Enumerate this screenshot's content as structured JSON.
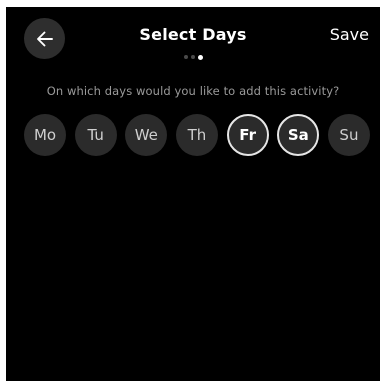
{
  "header": {
    "back_icon": "arrow-left-icon",
    "title": "Select Days",
    "save_label": "Save",
    "page_indicator": {
      "total": 3,
      "current": 3
    }
  },
  "prompt": "On which days would you like to add this activity?",
  "days": [
    {
      "label": "Mo",
      "selected": false
    },
    {
      "label": "Tu",
      "selected": false
    },
    {
      "label": "We",
      "selected": false
    },
    {
      "label": "Th",
      "selected": false
    },
    {
      "label": "Fr",
      "selected": true
    },
    {
      "label": "Sa",
      "selected": true
    },
    {
      "label": "Su",
      "selected": false
    }
  ],
  "colors": {
    "background": "#000000",
    "day_button": "#2b2b2b",
    "selected_ring": "#e6e6e6",
    "prompt_text": "#9a9a9a"
  }
}
